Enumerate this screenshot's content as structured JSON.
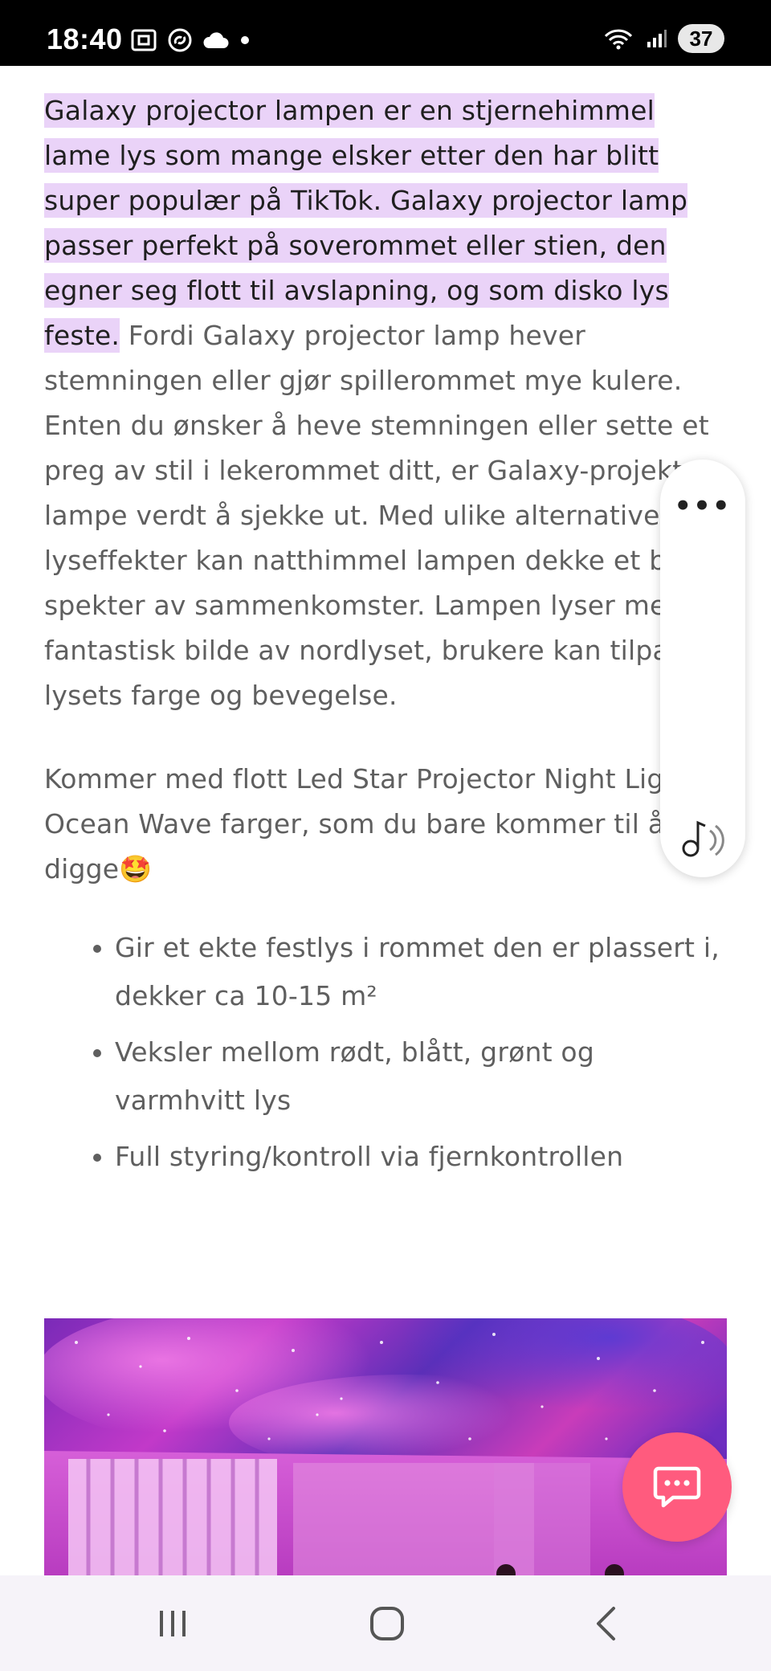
{
  "status_bar": {
    "time": "18:40",
    "battery": "37",
    "icons_left": [
      "screenshot-icon",
      "shazam-icon",
      "cloud-icon",
      "notification-dot-icon"
    ],
    "icons_right": [
      "wifi-icon",
      "signal-icon"
    ]
  },
  "article": {
    "highlighted_intro": "Galaxy projector lampen er en stjernehimmel lame lys som mange elsker etter den har blitt super populær på TikTok. Galaxy projector lamp passer perfekt på soverommet eller stien, den egner seg flott til avslapning, og som disko lys feste.",
    "intro_rest": "  Fordi Galaxy projector lamp hever stemningen eller gjør spillerommet mye kulere.  Enten du ønsker å heve stemningen eller sette et preg av stil i lekerommet ditt, er Galaxy-projektor lampe verdt å sjekke ut. Med ulike alternativer for lyseffekter kan natthimmel lampen dekke et bredt spekter av sammenkomster. Lampen lyser med et fantastisk bilde av nordlyset, brukere kan tilpasse lysets farge og bevegelse.",
    "para2": "Kommer med flott Led Star Projector Night Light Ocean Wave farger, som du bare kommer til å digge",
    "para2_emoji": "🤩",
    "features": [
      "Gir et ekte festlys i rommet den er plassert i, dekker ca 10-15 m²",
      "Veksler mellom rødt, blått, grønt og varmhvitt lys",
      "Full styring/kontroll via fjernkontrollen"
    ]
  },
  "floating_panel": {
    "more": "•••",
    "icon": "text-to-speech-icon"
  },
  "chat_button": {
    "icon": "chat-bubble-icon",
    "color": "#ff5b7e"
  },
  "nav_bar": {
    "buttons": [
      "recent-apps",
      "home",
      "back"
    ]
  },
  "colors": {
    "highlight": "#ead3f8",
    "text": "#5f5f5f",
    "accent": "#ff5b7e"
  }
}
